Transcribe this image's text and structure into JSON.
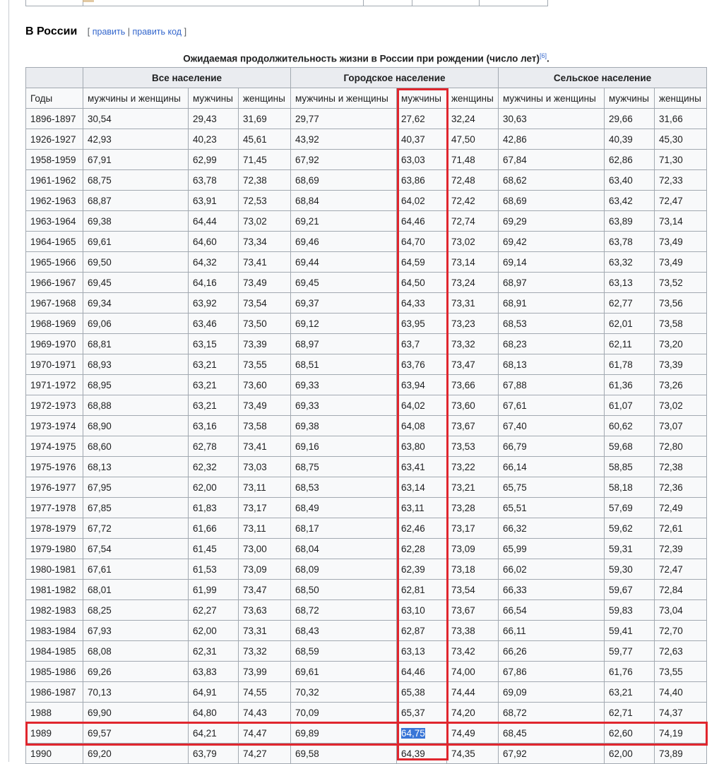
{
  "section": {
    "title": "В России",
    "edit_open": "[",
    "edit_label": "править",
    "edit_sep": "|",
    "edit_code_label": "править код",
    "edit_close": "]"
  },
  "caption": {
    "text": "Ожидаемая продолжительность жизни в России при рождении (число лет)",
    "ref": "[6]",
    "end": "."
  },
  "table": {
    "groups": [
      "Все население",
      "Городское население",
      "Сельское население"
    ],
    "year_header": "Годы",
    "sub_headers": [
      "мужчины и женщины",
      "мужчины",
      "женщины",
      "мужчины и женщины",
      "мужчины",
      "женщины",
      "мужчины и женщины",
      "мужчины",
      "женщины"
    ],
    "rows": [
      [
        "1896-1897",
        "30,54",
        "29,43",
        "31,69",
        "29,77",
        "27,62",
        "32,24",
        "30,63",
        "29,66",
        "31,66"
      ],
      [
        "1926-1927",
        "42,93",
        "40,23",
        "45,61",
        "43,92",
        "40,37",
        "47,50",
        "42,86",
        "40,39",
        "45,30"
      ],
      [
        "1958-1959",
        "67,91",
        "62,99",
        "71,45",
        "67,92",
        "63,03",
        "71,48",
        "67,84",
        "62,86",
        "71,30"
      ],
      [
        "1961-1962",
        "68,75",
        "63,78",
        "72,38",
        "68,69",
        "63,86",
        "72,48",
        "68,62",
        "63,40",
        "72,33"
      ],
      [
        "1962-1963",
        "68,87",
        "63,91",
        "72,53",
        "68,84",
        "64,02",
        "72,42",
        "68,69",
        "63,42",
        "72,47"
      ],
      [
        "1963-1964",
        "69,38",
        "64,44",
        "73,02",
        "69,21",
        "64,46",
        "72,74",
        "69,29",
        "63,89",
        "73,14"
      ],
      [
        "1964-1965",
        "69,61",
        "64,60",
        "73,34",
        "69,46",
        "64,70",
        "73,02",
        "69,42",
        "63,78",
        "73,49"
      ],
      [
        "1965-1966",
        "69,50",
        "64,32",
        "73,41",
        "69,44",
        "64,59",
        "73,14",
        "69,14",
        "63,32",
        "73,49"
      ],
      [
        "1966-1967",
        "69,45",
        "64,16",
        "73,49",
        "69,45",
        "64,50",
        "73,24",
        "68,97",
        "63,13",
        "73,52"
      ],
      [
        "1967-1968",
        "69,34",
        "63,92",
        "73,54",
        "69,37",
        "64,33",
        "73,31",
        "68,91",
        "62,77",
        "73,56"
      ],
      [
        "1968-1969",
        "69,06",
        "63,46",
        "73,50",
        "69,12",
        "63,95",
        "73,23",
        "68,53",
        "62,01",
        "73,58"
      ],
      [
        "1969-1970",
        "68,81",
        "63,15",
        "73,39",
        "68,97",
        "63,7",
        "73,32",
        "68,23",
        "62,11",
        "73,20"
      ],
      [
        "1970-1971",
        "68,93",
        "63,21",
        "73,55",
        "68,51",
        "63,76",
        "73,47",
        "68,13",
        "61,78",
        "73,39"
      ],
      [
        "1971-1972",
        "68,95",
        "63,21",
        "73,60",
        "69,33",
        "63,94",
        "73,66",
        "67,88",
        "61,36",
        "73,26"
      ],
      [
        "1972-1973",
        "68,88",
        "63,21",
        "73,49",
        "69,33",
        "64,02",
        "73,60",
        "67,61",
        "61,07",
        "73,02"
      ],
      [
        "1973-1974",
        "68,90",
        "63,16",
        "73,58",
        "69,38",
        "64,08",
        "73,67",
        "67,40",
        "60,62",
        "73,07"
      ],
      [
        "1974-1975",
        "68,60",
        "62,78",
        "73,41",
        "69,16",
        "63,80",
        "73,53",
        "66,79",
        "59,68",
        "72,80"
      ],
      [
        "1975-1976",
        "68,13",
        "62,32",
        "73,03",
        "68,75",
        "63,41",
        "73,22",
        "66,14",
        "58,85",
        "72,38"
      ],
      [
        "1976-1977",
        "67,95",
        "62,00",
        "73,11",
        "68,53",
        "63,14",
        "73,21",
        "65,75",
        "58,18",
        "72,36"
      ],
      [
        "1977-1978",
        "67,85",
        "61,83",
        "73,17",
        "68,49",
        "63,11",
        "73,28",
        "65,51",
        "57,69",
        "72,49"
      ],
      [
        "1978-1979",
        "67,72",
        "61,66",
        "73,11",
        "68,17",
        "62,46",
        "73,17",
        "66,32",
        "59,62",
        "72,61"
      ],
      [
        "1979-1980",
        "67,54",
        "61,45",
        "73,00",
        "68,04",
        "62,28",
        "73,09",
        "65,99",
        "59,31",
        "72,39"
      ],
      [
        "1980-1981",
        "67,61",
        "61,53",
        "73,09",
        "68,09",
        "62,39",
        "73,18",
        "66,02",
        "59,30",
        "72,47"
      ],
      [
        "1981-1982",
        "68,01",
        "61,99",
        "73,47",
        "68,50",
        "62,81",
        "73,54",
        "66,33",
        "59,67",
        "72,84"
      ],
      [
        "1982-1983",
        "68,25",
        "62,27",
        "73,63",
        "68,72",
        "63,10",
        "73,67",
        "66,54",
        "59,83",
        "73,04"
      ],
      [
        "1983-1984",
        "67,93",
        "62,00",
        "73,31",
        "68,43",
        "62,87",
        "73,38",
        "66,11",
        "59,41",
        "72,70"
      ],
      [
        "1984-1985",
        "68,08",
        "62,31",
        "73,32",
        "68,59",
        "63,13",
        "73,42",
        "66,26",
        "59,77",
        "72,63"
      ],
      [
        "1985-1986",
        "69,26",
        "63,83",
        "73,99",
        "69,61",
        "64,46",
        "74,00",
        "67,86",
        "61,76",
        "73,55"
      ],
      [
        "1986-1987",
        "70,13",
        "64,91",
        "74,55",
        "70,32",
        "65,38",
        "74,44",
        "69,09",
        "63,21",
        "74,40"
      ],
      [
        "1988",
        "69,90",
        "64,80",
        "74,43",
        "70,09",
        "65,37",
        "74,20",
        "68,72",
        "62,71",
        "74,37"
      ],
      [
        "1989",
        "69,57",
        "64,21",
        "74,47",
        "69,89",
        "64,75",
        "74,49",
        "68,45",
        "62,60",
        "74,19"
      ],
      [
        "1990",
        "69,20",
        "63,79",
        "74,27",
        "69,58",
        "64,39",
        "74,35",
        "67,92",
        "62,00",
        "73,89"
      ]
    ]
  },
  "highlight_color": "#e0262e",
  "selection_color": "#3875d7"
}
